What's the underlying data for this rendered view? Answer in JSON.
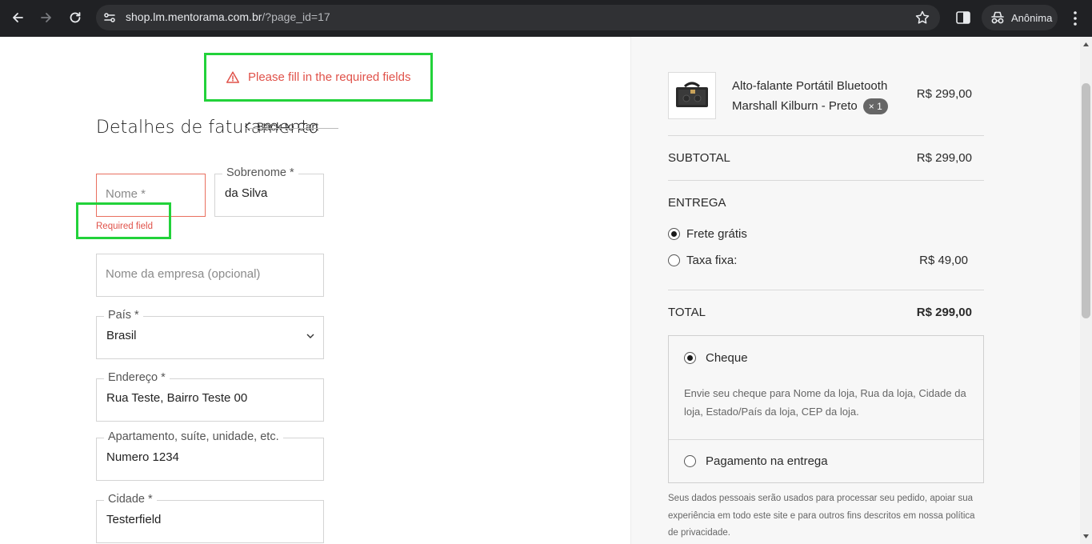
{
  "browser": {
    "url_host": "shop.lm.mentorama.com.br",
    "url_path": "/?page_id=17",
    "profile_label": "Anônima",
    "icons": [
      "back-arrow-icon",
      "forward-arrow-icon",
      "reload-icon",
      "site-info-icon",
      "star-icon",
      "split-view-icon",
      "incognito-icon",
      "menu-dots-icon"
    ]
  },
  "notice": {
    "text": "Please fill in the required fields",
    "color": "#e0524a"
  },
  "billing": {
    "title": "Detalhes de faturamento",
    "back_link": "Back to Cart",
    "fields": {
      "first_name": {
        "placeholder": "Nome *",
        "error": "Required field"
      },
      "last_name": {
        "label": "Sobrenome *",
        "value": "da Silva"
      },
      "company": {
        "placeholder": "Nome da empresa (opcional)"
      },
      "country": {
        "label": "País *",
        "value": "Brasil"
      },
      "address": {
        "label": "Endereço *",
        "value": "Rua Teste, Bairro Teste 00"
      },
      "apartment": {
        "label": "Apartamento, suíte, unidade, etc.",
        "value": "Numero 1234"
      },
      "city": {
        "label": "Cidade *",
        "value": "Testerfield"
      }
    }
  },
  "order": {
    "product": {
      "name": "Alto-falante Portátil Bluetooth Marshall Kilburn - Preto",
      "qty": "× 1",
      "price": "R$ 299,00"
    },
    "subtotal_label": "SUBTOTAL",
    "subtotal_value": "R$ 299,00",
    "shipping_label": "ENTREGA",
    "shipping_options": [
      {
        "label": "Frete grátis",
        "price": "",
        "checked": true
      },
      {
        "label": "Taxa fixa:",
        "price": "R$ 49,00",
        "checked": false
      }
    ],
    "total_label": "TOTAL",
    "total_value": "R$ 299,00",
    "payment_options": [
      {
        "label": "Cheque",
        "checked": true
      },
      {
        "label": "Pagamento na entrega",
        "checked": false
      }
    ],
    "cheque_description": "Envie seu cheque para Nome da loja, Rua da loja, Cidade da loja, Estado/País da loja, CEP da loja.",
    "privacy_text": "Seus dados pessoais serão usados para processar seu pedido, apoiar sua experiência em todo este site e para outros fins descritos em nossa política de privacidade."
  },
  "colors": {
    "chrome_bg": "#202124",
    "error": "#e0524a",
    "highlight": "#22d23a",
    "panel_bg": "#f7f7f7"
  }
}
